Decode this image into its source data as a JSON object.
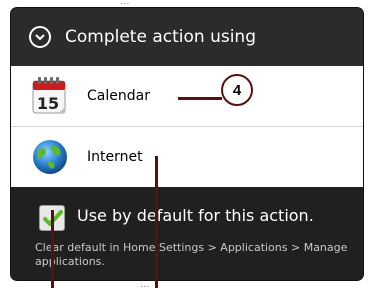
{
  "dialog": {
    "title": "Complete action using",
    "items": [
      {
        "label": "Calendar",
        "icon": "calendar-icon",
        "icon_text": "15"
      },
      {
        "label": "Internet",
        "icon": "globe-icon"
      }
    ],
    "default_checkbox": {
      "label": "Use by default for this action.",
      "checked": true
    },
    "hint": "Clear default in Home Settings > Applications > Manage applications."
  },
  "callout": {
    "number": "4"
  },
  "background": {
    "top_snippet": "...",
    "bottom_snippet": "..."
  },
  "colors": {
    "dialog_bg": "#222222",
    "accent_green": "#5cb82d",
    "callout_line": "#5a1010"
  }
}
